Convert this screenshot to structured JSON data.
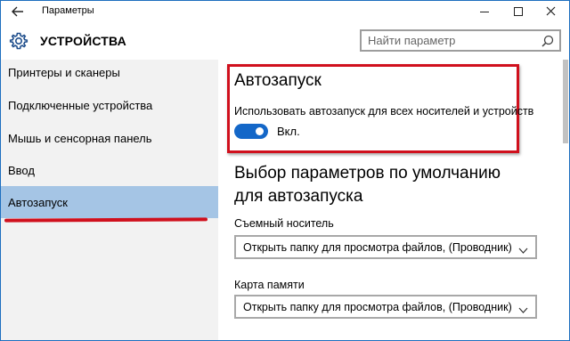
{
  "window": {
    "title": "Параметры",
    "back_icon": "back-arrow-icon",
    "controls": [
      "minimize-icon",
      "maximize-icon",
      "close-icon"
    ]
  },
  "header": {
    "section_title": "УСТРОЙСТВА",
    "section_icon": "gear-icon",
    "search": {
      "placeholder": "Найти параметр",
      "value": "",
      "icon": "search-icon"
    }
  },
  "sidebar": {
    "items": [
      {
        "label": "Принтеры и сканеры",
        "selected": false
      },
      {
        "label": "Подключенные устройства",
        "selected": false
      },
      {
        "label": "Мышь и сенсорная панель",
        "selected": false
      },
      {
        "label": "Ввод",
        "selected": false
      },
      {
        "label": "Автозапуск",
        "selected": true
      }
    ],
    "selected_color": "#a5c5e5"
  },
  "main": {
    "autoplay": {
      "heading": "Автозапуск",
      "description": "Использовать автозапуск для всех носителей и устройств",
      "toggle_on": true,
      "toggle_label": "Вкл."
    },
    "defaults_heading": "Выбор параметров по умолчанию для автозапуска",
    "removable": {
      "label": "Съемный носитель",
      "value": "Открыть папку для просмотра файлов, (Проводник)"
    },
    "memory_card": {
      "label": "Карта памяти",
      "value": "Открыть папку для просмотра файлов, (Проводник)"
    }
  },
  "colors": {
    "accent": "#1467c8",
    "highlight_red": "#d0101d",
    "sidebar_bg": "#f2f2f2"
  }
}
